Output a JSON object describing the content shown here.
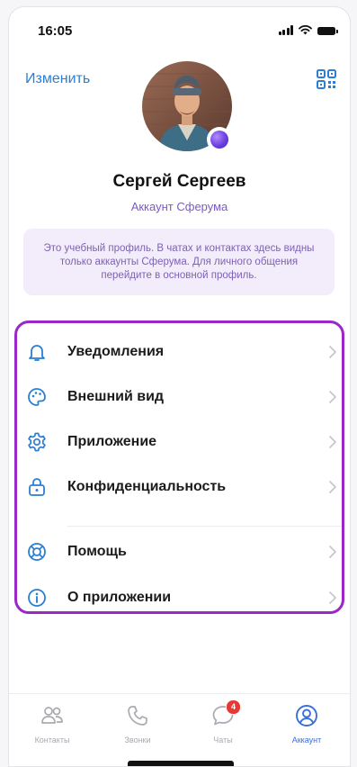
{
  "status_bar": {
    "time": "16:05"
  },
  "header": {
    "edit_label": "Изменить",
    "qr_icon": "qr-code-icon"
  },
  "profile": {
    "name": "Сергей Сергеев",
    "account_type": "Аккаунт Сферума"
  },
  "info_box": {
    "text": "Это учебный профиль. В чатах и контактах здесь видны только аккаунты Сферума. Для личного общения перейдите в основной профиль."
  },
  "menu": {
    "items": [
      {
        "label": "Уведомления",
        "icon": "bell-icon"
      },
      {
        "label": "Внешний вид",
        "icon": "palette-icon"
      },
      {
        "label": "Приложение",
        "icon": "gear-icon"
      },
      {
        "label": "Конфиденциальность",
        "icon": "lock-icon"
      },
      {
        "label": "Помощь",
        "icon": "lifebuoy-icon"
      },
      {
        "label": "О приложении",
        "icon": "info-icon"
      }
    ]
  },
  "tabbar": {
    "tabs": [
      {
        "label": "Контакты",
        "icon": "contacts-icon"
      },
      {
        "label": "Звонки",
        "icon": "phone-icon"
      },
      {
        "label": "Чаты",
        "icon": "chat-icon",
        "badge": "4"
      },
      {
        "label": "Аккаунт",
        "icon": "account-icon",
        "active": true
      }
    ]
  },
  "colors": {
    "accent_blue": "#2a7fd4",
    "sferum_purple": "#7c58c9",
    "highlight_frame": "#9c27c9",
    "badge_red": "#e53935",
    "info_bg": "#f2ecfb"
  }
}
